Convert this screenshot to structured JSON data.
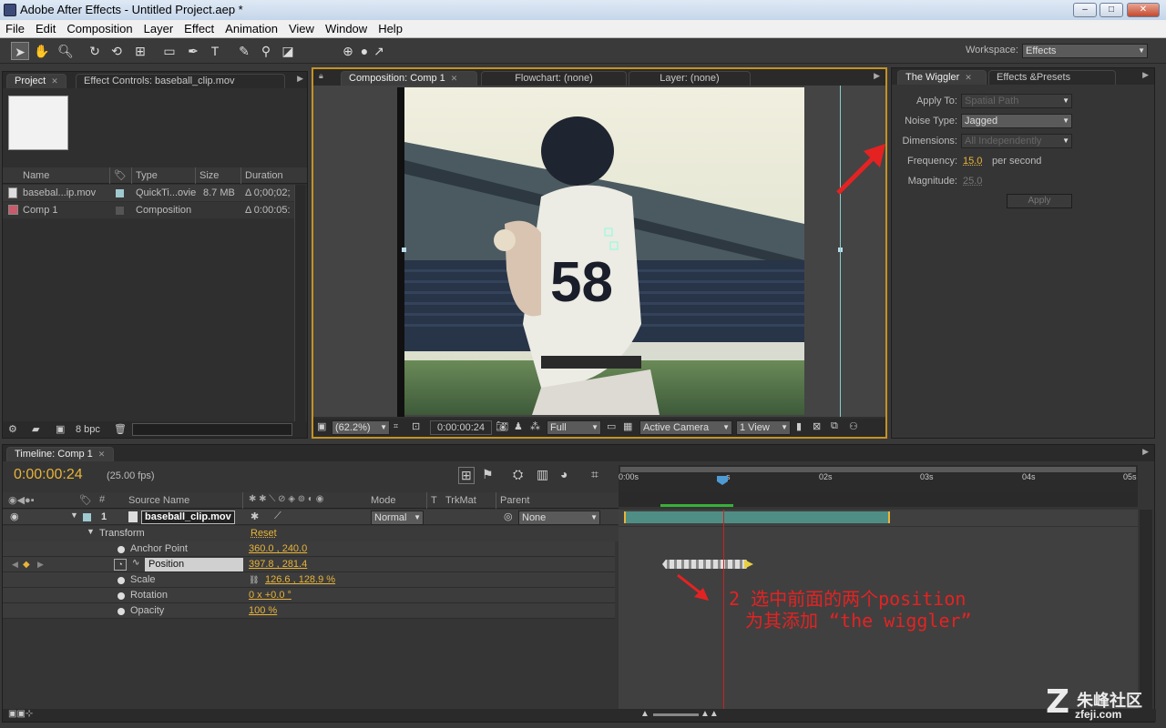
{
  "window": {
    "title": "Adobe After Effects - Untitled Project.aep *",
    "minimize": "–",
    "maximize": "□",
    "close": "✕"
  },
  "menu": [
    "File",
    "Edit",
    "Composition",
    "Layer",
    "Effect",
    "Animation",
    "View",
    "Window",
    "Help"
  ],
  "workspace": {
    "label": "Workspace:",
    "value": "Effects"
  },
  "project_panel": {
    "tabs": [
      "Project",
      "Effect Controls: baseball_clip.mov"
    ],
    "columns": [
      "Name",
      "Type",
      "Size",
      "Duration"
    ],
    "items": [
      {
        "name": "basebal...ip.mov",
        "type": "QuickTi...ovie",
        "size": "8.7 MB",
        "duration": "Δ 0;00;02;"
      },
      {
        "name": "Comp 1",
        "type": "Composition",
        "size": "",
        "duration": "Δ 0:00:05:"
      }
    ],
    "bpc": "8 bpc"
  },
  "comp_panel": {
    "tabs": [
      "Composition: Comp 1",
      "Flowchart: (none)",
      "Layer: (none)"
    ],
    "zoom": "(62.2%)",
    "timecode": "0:00:00:24",
    "resolution": "Full",
    "camera": "Active Camera",
    "views": "1 View"
  },
  "wiggler_panel": {
    "tabs": [
      "The Wiggler",
      "Effects &Presets"
    ],
    "apply_to": {
      "label": "Apply To:",
      "value": "Spatial Path"
    },
    "noise_type": {
      "label": "Noise Type:",
      "value": "Jagged"
    },
    "dimensions": {
      "label": "Dimensions:",
      "value": "All Independently"
    },
    "frequency": {
      "label": "Frequency:",
      "value": "15.0",
      "unit": "per second"
    },
    "magnitude": {
      "label": "Magnitude:",
      "value": "25.0"
    },
    "apply_button": "Apply"
  },
  "timeline": {
    "tab": "Timeline: Comp 1",
    "timecode": "0:00:00:24",
    "fps": "(25.00 fps)",
    "columns": {
      "source": "Source Name",
      "mode": "Mode",
      "t": "T",
      "trkmat": "TrkMat",
      "parent": "Parent"
    },
    "layer": {
      "num": "1",
      "name": "baseball_clip.mov",
      "mode": "Normal",
      "parent": "None"
    },
    "transform": {
      "label": "Transform",
      "reset": "Reset"
    },
    "properties": [
      {
        "name": "Anchor Point",
        "value": "360.0 , 240.0"
      },
      {
        "name": "Position",
        "value": "397.8 , 281.4"
      },
      {
        "name": "Scale",
        "value": "126.6 , 128.9 %"
      },
      {
        "name": "Rotation",
        "value": "0 x +0.0 °"
      },
      {
        "name": "Opacity",
        "value": "100 %"
      }
    ],
    "ruler": [
      "0:00s",
      "s",
      "02s",
      "03s",
      "04s",
      "05s"
    ]
  },
  "annotation": {
    "line1": "2 选中前面的两个position",
    "line2": "为其添加 “the wiggler”"
  },
  "watermark": {
    "line1": "朱峰社区",
    "line2": "zfeji.com"
  },
  "colors": {
    "accent": "#e8b43a",
    "annotation": "#e52222",
    "panel": "#2f2f2f"
  }
}
